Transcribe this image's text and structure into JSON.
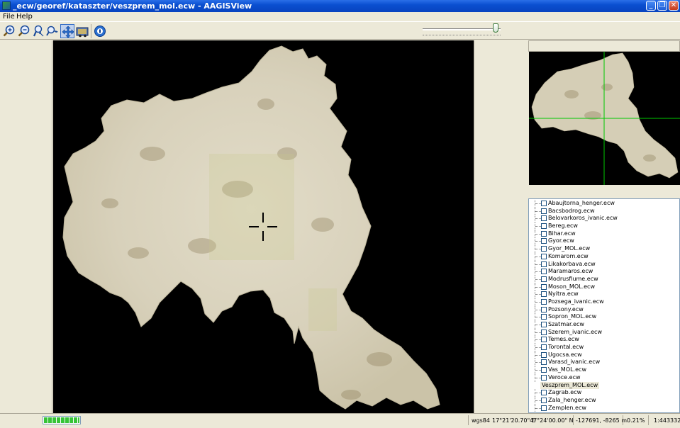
{
  "window": {
    "title": "_ecw/georef/kataszter/veszprem_mol.ecw - AAGISView",
    "minimize_glyph": "_",
    "maximize_glyph": "❐",
    "close_glyph": "✕"
  },
  "menu": {
    "items": [
      "File",
      "Help"
    ]
  },
  "toolbar": {
    "buttons": [
      {
        "icon": "zoom-in-icon"
      },
      {
        "icon": "zoom-out-icon"
      },
      {
        "icon": "zoom-box-icon"
      },
      {
        "icon": "pan-icon"
      },
      {
        "icon": "move-tool-icon",
        "active": true
      },
      {
        "icon": "full-extent-icon"
      },
      {
        "icon": "info-icon"
      }
    ],
    "zoom_slider_level": 0.95
  },
  "layers": {
    "items": [
      {
        "label": "Abaujtorna_henger.ecw",
        "checked": false
      },
      {
        "label": "Bacsbodrog.ecw",
        "checked": false
      },
      {
        "label": "Belovarkoros_ivanic.ecw",
        "checked": false
      },
      {
        "label": "Bereg.ecw",
        "checked": false
      },
      {
        "label": "Bihar.ecw",
        "checked": false
      },
      {
        "label": "Gyor.ecw",
        "checked": false
      },
      {
        "label": "Gyor_MOL.ecw",
        "checked": false
      },
      {
        "label": "Komarom.ecw",
        "checked": false
      },
      {
        "label": "Likakorbava.ecw",
        "checked": false
      },
      {
        "label": "Maramaros.ecw",
        "checked": false
      },
      {
        "label": "Modrusfiume.ecw",
        "checked": false
      },
      {
        "label": "Moson_MOL.ecw",
        "checked": false
      },
      {
        "label": "Nyitra.ecw",
        "checked": false
      },
      {
        "label": "Pozsega_ivanic.ecw",
        "checked": false
      },
      {
        "label": "Pozsony.ecw",
        "checked": false
      },
      {
        "label": "Sopron_MOL.ecw",
        "checked": false
      },
      {
        "label": "Szatmar.ecw",
        "checked": false
      },
      {
        "label": "Szerem_ivanic.ecw",
        "checked": false
      },
      {
        "label": "Temes.ecw",
        "checked": false
      },
      {
        "label": "Torontal.ecw",
        "checked": false
      },
      {
        "label": "Ugocsa.ecw",
        "checked": false
      },
      {
        "label": "Varasd_ivanic.ecw",
        "checked": false
      },
      {
        "label": "Vas_MOL.ecw",
        "checked": false
      },
      {
        "label": "Veroce.ecw",
        "checked": false
      },
      {
        "label": "Veszprem_MOL.ecw",
        "checked": true,
        "selected": true
      },
      {
        "label": "Zagrab.ecw",
        "checked": false
      },
      {
        "label": "Zala_henger.ecw",
        "checked": false
      },
      {
        "label": "Zemplen.ecw",
        "checked": false
      }
    ]
  },
  "status": {
    "progress": 1.0,
    "datum": "wgs84",
    "longitude": "17°21'20.70\" E",
    "latitude": "47°24'00.00\" N",
    "projected": "-127691, -8265 m",
    "percent": "0.21%",
    "scale": "1:443332"
  },
  "colors": {
    "titlebar": "#0a4fd0",
    "map_background": "#000000",
    "map_parchment": "#d9d3bf",
    "overview_crosshair": "#00c800"
  }
}
